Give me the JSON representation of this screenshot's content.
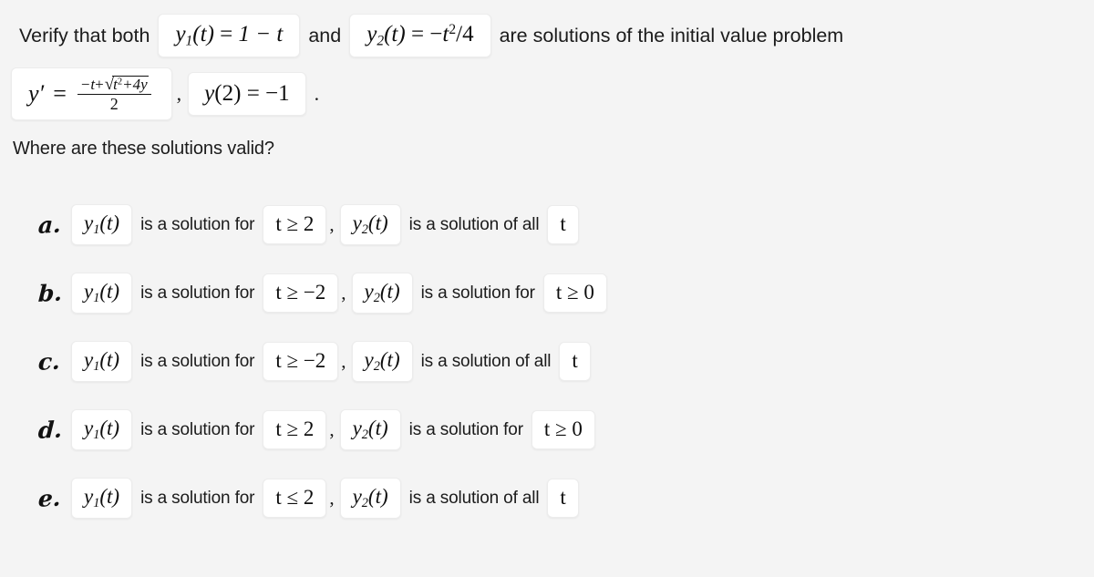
{
  "prompt": {
    "lead": "Verify that both",
    "expr_y1": {
      "fn": "y",
      "sub": "1",
      "arg": "(t)",
      "eq": "=",
      "rhs": "1 − t"
    },
    "conjunction": "and",
    "expr_y2": {
      "fn": "y",
      "sub": "2",
      "arg": "(t)",
      "eq": "=",
      "rhs": "−t²/4"
    },
    "tail": "are solutions of the initial value problem"
  },
  "ode": {
    "lhs": "y′",
    "eq": "=",
    "numerator": "−t + √(t² + 4y)",
    "numerator_parts": {
      "minus_t": "−t",
      "plus": "+",
      "radical_sign": "√",
      "radicand_t": "t",
      "radicand_sup": "2",
      "radicand_rest": "+4y"
    },
    "denominator": "2",
    "separator": ",",
    "initial_condition": "y(2) = −1",
    "initial_condition_parts": {
      "fn": "y",
      "arg": "(2)",
      "eq": "=",
      "value": "−1"
    },
    "period": "."
  },
  "question": "Where are these solutions valid?",
  "options": [
    {
      "letter": "a.",
      "expr1": {
        "fn": "y",
        "sub": "1",
        "arg": "(t)"
      },
      "text1": "is a solution for",
      "cond1": "t ≥ 2",
      "comma": ",",
      "expr2": {
        "fn": "y",
        "sub": "2",
        "arg": "(t)"
      },
      "text2": "is a solution of all",
      "cond2": "t"
    },
    {
      "letter": "b.",
      "expr1": {
        "fn": "y",
        "sub": "1",
        "arg": "(t)"
      },
      "text1": "is a solution for",
      "cond1": "t ≥ −2",
      "comma": ",",
      "expr2": {
        "fn": "y",
        "sub": "2",
        "arg": "(t)"
      },
      "text2": "is a solution for",
      "cond2": "t ≥ 0"
    },
    {
      "letter": "c.",
      "expr1": {
        "fn": "y",
        "sub": "1",
        "arg": "(t)"
      },
      "text1": "is a solution for",
      "cond1": "t ≥ −2",
      "comma": ",",
      "expr2": {
        "fn": "y",
        "sub": "2",
        "arg": "(t)"
      },
      "text2": "is a solution of all",
      "cond2": "t"
    },
    {
      "letter": "d.",
      "expr1": {
        "fn": "y",
        "sub": "1",
        "arg": "(t)"
      },
      "text1": "is a solution for",
      "cond1": "t ≥ 2",
      "comma": ",",
      "expr2": {
        "fn": "y",
        "sub": "2",
        "arg": "(t)"
      },
      "text2": "is a solution for",
      "cond2": "t ≥ 0"
    },
    {
      "letter": "e.",
      "expr1": {
        "fn": "y",
        "sub": "1",
        "arg": "(t)"
      },
      "text1": "is a solution for",
      "cond1": "t ≤ 2",
      "comma": ",",
      "expr2": {
        "fn": "y",
        "sub": "2",
        "arg": "(t)"
      },
      "text2": "is a solution of all",
      "cond2": "t"
    }
  ],
  "colors": {
    "background": "#f4f4f4",
    "box_background": "#ffffff",
    "box_border": "#ececec",
    "text": "#1b1b1b"
  }
}
